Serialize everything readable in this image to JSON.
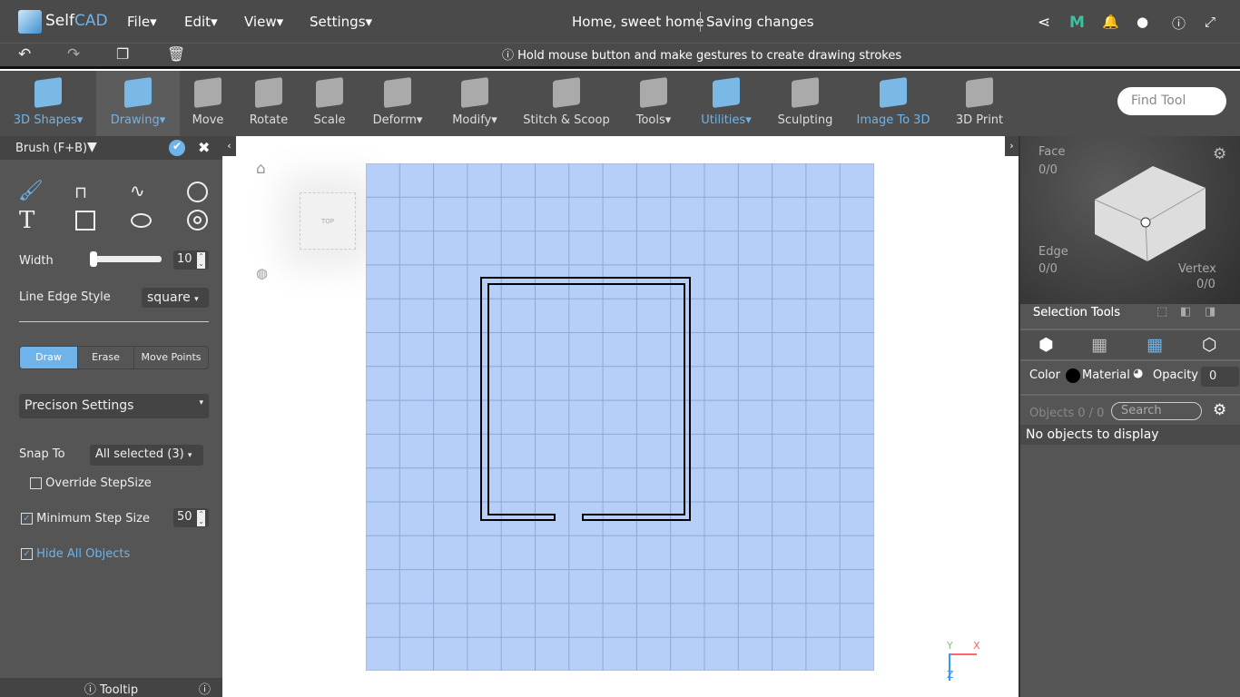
{
  "app": {
    "logo": "SelfCAD",
    "menus": [
      "File",
      "Edit",
      "View",
      "Settings"
    ],
    "project_title": "Home, sweet home",
    "save_status": "Saving changes"
  },
  "hint": "Hold mouse button and make gestures to create drawing strokes",
  "toolbar": {
    "tools": [
      {
        "label": "3D Shapes",
        "dropdown": true,
        "icon": "cube-icon"
      },
      {
        "label": "Drawing",
        "dropdown": true,
        "icon": "drawing-icon",
        "active": true
      },
      {
        "label": "Move",
        "icon": "move-icon"
      },
      {
        "label": "Rotate",
        "icon": "rotate-icon"
      },
      {
        "label": "Scale",
        "icon": "scale-icon"
      },
      {
        "label": "Deform",
        "dropdown": true,
        "icon": "deform-icon"
      },
      {
        "label": "Modify",
        "dropdown": true,
        "icon": "modify-icon"
      },
      {
        "label": "Stitch & Scoop",
        "icon": "stitch-icon"
      },
      {
        "label": "Tools",
        "dropdown": true,
        "icon": "tools-icon"
      },
      {
        "label": "Utilities",
        "dropdown": true,
        "icon": "utilities-icon"
      },
      {
        "label": "Sculpting",
        "icon": "sculpting-icon"
      },
      {
        "label": "Image To 3D",
        "icon": "image-icon"
      },
      {
        "label": "3D Print",
        "icon": "print-icon"
      }
    ],
    "find_placeholder": "Find Tool"
  },
  "panel": {
    "title": "Brush (F+B)",
    "width_label": "Width",
    "width_value": "10",
    "width_fraction": 0.05,
    "edge_label": "Line Edge Style",
    "edge_value": "square",
    "modes": [
      "Draw",
      "Erase",
      "Move Points"
    ],
    "active_mode": "Draw",
    "precision": "Precison Settings",
    "snap_label": "Snap To",
    "snap_value": "All selected (3)",
    "override": "Override StepSize",
    "override_checked": false,
    "min_step": "Minimum Step Size",
    "min_step_checked": true,
    "min_step_value": "50",
    "hide_all": "Hide All Objects",
    "hide_all_checked": true,
    "tooltip": "Tooltip"
  },
  "viewcube": {
    "label": "TOP"
  },
  "axes": {
    "x": "X",
    "y": "Y",
    "z": "Z"
  },
  "right": {
    "face": "Face",
    "face_count": "0/0",
    "edge": "Edge",
    "edge_count": "0/0",
    "vertex": "Vertex",
    "vertex_count": "0/0",
    "selection_tools": "Selection Tools",
    "color": "Color",
    "material": "Material",
    "opacity": "Opacity",
    "opacity_value": "0",
    "objects": "Objects 0 / 0",
    "search_placeholder": "Search",
    "empty": "No objects to display"
  },
  "colors": {
    "accent": "#6fb3e8",
    "grid": "#b5cff9"
  }
}
